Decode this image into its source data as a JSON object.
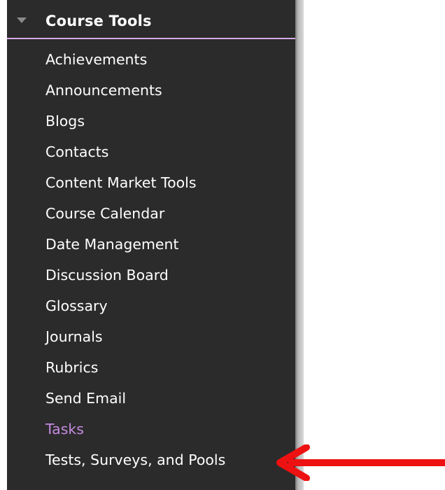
{
  "panel": {
    "title": "Course Tools",
    "items": [
      {
        "label": "Achievements"
      },
      {
        "label": "Announcements"
      },
      {
        "label": "Blogs"
      },
      {
        "label": "Contacts"
      },
      {
        "label": "Content Market Tools"
      },
      {
        "label": "Course Calendar"
      },
      {
        "label": "Date Management"
      },
      {
        "label": "Discussion Board"
      },
      {
        "label": "Glossary"
      },
      {
        "label": "Journals"
      },
      {
        "label": "Rubrics"
      },
      {
        "label": "Send Email"
      },
      {
        "label": "Tasks"
      },
      {
        "label": "Tests, Surveys, and Pools"
      }
    ],
    "active_item": "Tasks"
  },
  "colors": {
    "panel_bg": "#2b2b2b",
    "active_text": "#c58be0",
    "header_underline": "#d6a8e6",
    "arrow": "#ee1111"
  },
  "annotation": {
    "arrow_target": "Tests, Surveys, and Pools"
  }
}
